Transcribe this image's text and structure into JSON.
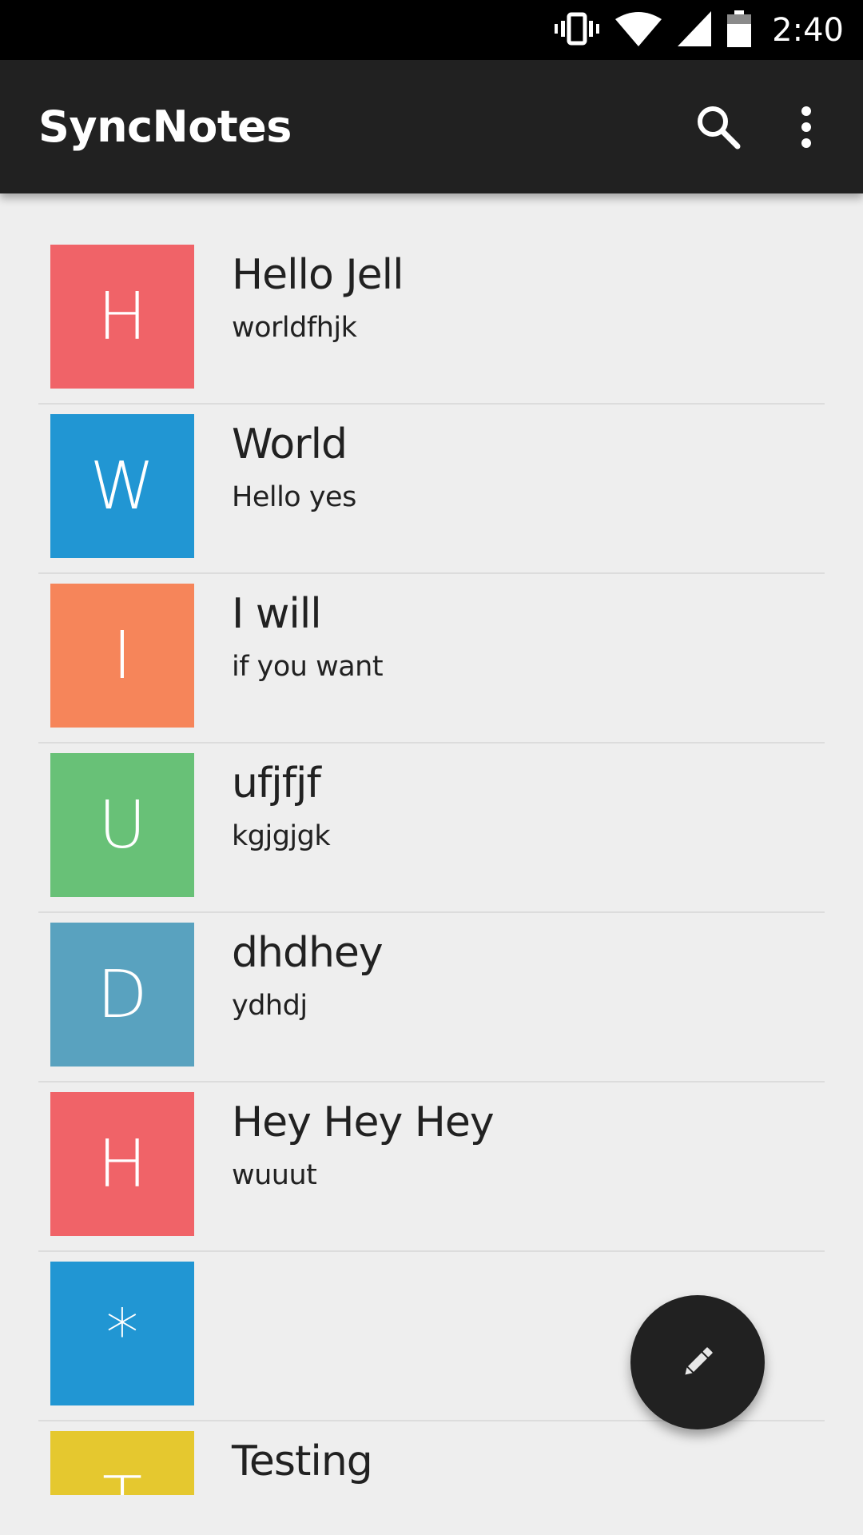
{
  "status_bar": {
    "time": "2:40",
    "icons": [
      "vibrate-icon",
      "wifi-icon",
      "cell-signal-icon",
      "battery-icon"
    ]
  },
  "toolbar": {
    "title": "SyncNotes",
    "search_icon": "search-icon",
    "more_icon": "more-vert-icon",
    "background": "#212121"
  },
  "notes": [
    {
      "initial": "H",
      "title": "Hello Jell",
      "body": "worldfhjk",
      "color": "#f06368"
    },
    {
      "initial": "W",
      "title": "World",
      "body": "Hello yes",
      "color": "#2196d3"
    },
    {
      "initial": "I",
      "title": "I will",
      "body": "if you want",
      "color": "#f6855a"
    },
    {
      "initial": "U",
      "title": "ufjfjf",
      "body": "kgjgjgk",
      "color": "#68c177"
    },
    {
      "initial": "D",
      "title": "dhdhey",
      "body": "ydhdj",
      "color": "#59a2bf"
    },
    {
      "initial": "H",
      "title": "Hey Hey Hey",
      "body": "wuuut",
      "color": "#f06368"
    },
    {
      "initial": "*",
      "title": "",
      "body": "",
      "color": "#2196d3"
    },
    {
      "initial": "T",
      "title": "Testing",
      "body": "",
      "color": "#e5c82f"
    }
  ],
  "fab": {
    "icon": "pencil-icon",
    "background": "#212121"
  }
}
